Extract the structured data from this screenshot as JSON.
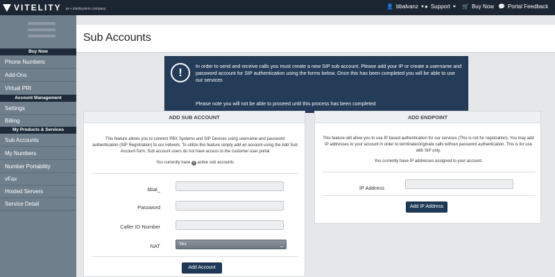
{
  "topbar": {
    "brand": "VITELITY",
    "brand_sub": "an • intelisystem company",
    "user": "bbalvanz",
    "support": "Support",
    "buy_now": "Buy Now",
    "portal_feedback": "Portal Feedback"
  },
  "sidebar": {
    "head_buy_now": "Buy Now",
    "item_phone_numbers": "Phone Numbers",
    "item_add_ons": "Add-Ons",
    "item_virtual_pri": "Virtual PRI",
    "head_account_management": "Account Management",
    "item_settings": "Settings",
    "item_billing": "Billing",
    "head_products": "My Products & Services",
    "item_sub_accounts": "Sub Accounts",
    "item_my_numbers": "My Numbers",
    "item_number_portability": "Number Portability",
    "item_vfax": "vFax",
    "item_hosted_servers": "Hosted Servers",
    "item_service_detail": "Service Detail"
  },
  "page": {
    "title": "Sub Accounts"
  },
  "notice": {
    "icon": "!",
    "text": "In order to send and receive calls you must create a new SIP sub account. Please add your IP or create a username and password account for SIP authentication using the forms below. Once this has been completed you will be able to use our services",
    "text2": "Please note you will not be able to proceed until this process has been completed"
  },
  "add_sub_account": {
    "header": "ADD SUB ACCOUNT",
    "description": "This feature allows you to connect PBX Systems and SIP Devices using username and password authentication (SIP Registration) to our network. To utilize this feature simply add an account using the Add Sub Account form. Sub account users do not have access to the customer user portal",
    "count_prefix": "You currently have",
    "count": "0",
    "count_suffix": "active sub accounts",
    "label_username": "bbal_",
    "label_password": "Password",
    "label_caller_id": "Caller ID Number",
    "label_nat": "NAT",
    "nat_value": "Yes",
    "button": "Add Account"
  },
  "add_endpoint": {
    "header": "ADD ENDPOINT",
    "description": "This feature will allow you to use IP based authentication for our services (This is not for registration). You may add IP addresses to your account in order to terminate/originate calls without password authentication. This is for use with SIP only.",
    "count_text": "You currently have IP addresses assigned to your account.",
    "label_ip": "IP Address",
    "button": "Add IP Address"
  }
}
